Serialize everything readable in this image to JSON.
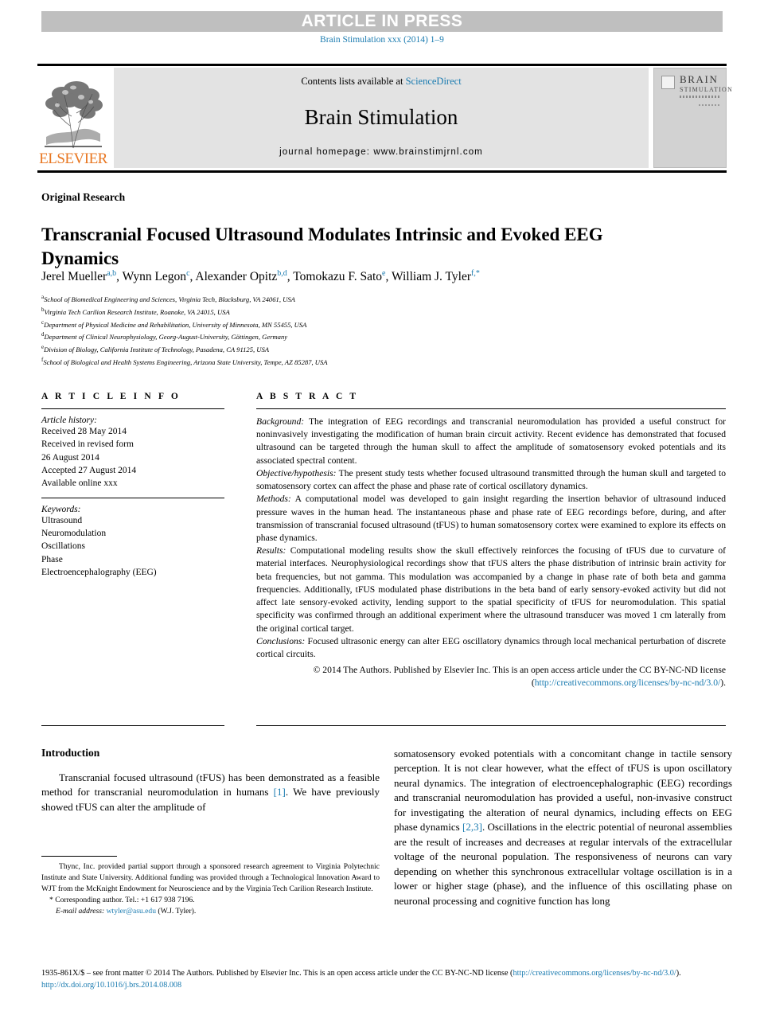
{
  "banner": {
    "text": "ARTICLE IN PRESS"
  },
  "journal_ref": "Brain Stimulation xxx (2014) 1–9",
  "masthead": {
    "contents_prefix": "Contents lists available at ",
    "sciencedirect": "ScienceDirect",
    "journal_title": "Brain Stimulation",
    "homepage": "journal homepage: www.brainstimjrnl.com",
    "publisher": "ELSEVIER",
    "cover_title_top": "BRAIN",
    "cover_title_bottom": "STIMULATION"
  },
  "article": {
    "kind": "Original Research",
    "title": "Transcranial Focused Ultrasound Modulates Intrinsic and Evoked EEG Dynamics",
    "authors": [
      {
        "name": "Jerel Mueller",
        "sup": "a,b"
      },
      {
        "name": "Wynn Legon",
        "sup": "c"
      },
      {
        "name": "Alexander Opitz",
        "sup": "b,d"
      },
      {
        "name": "Tomokazu F. Sato",
        "sup": "e"
      },
      {
        "name": "William J. Tyler",
        "sup": "f,*"
      }
    ],
    "affiliations": [
      {
        "mark": "a",
        "text": "School of Biomedical Engineering and Sciences, Virginia Tech, Blacksburg, VA 24061, USA"
      },
      {
        "mark": "b",
        "text": "Virginia Tech Carilion Research Institute, Roanoke, VA 24015, USA"
      },
      {
        "mark": "c",
        "text": "Department of Physical Medicine and Rehabilitation, University of Minnesota, MN 55455, USA"
      },
      {
        "mark": "d",
        "text": "Department of Clinical Neurophysiology, Georg-August-University, Göttingen, Germany"
      },
      {
        "mark": "e",
        "text": "Division of Biology, California Institute of Technology, Pasadena, CA 91125, USA"
      },
      {
        "mark": "f",
        "text": "School of Biological and Health Systems Engineering, Arizona State University, Tempe, AZ 85287, USA"
      }
    ]
  },
  "info": {
    "heading": "A R T I C L E   I N F O",
    "history_label": "Article history:",
    "history": [
      "Received 28 May 2014",
      "Received in revised form",
      "26 August 2014",
      "Accepted 27 August 2014",
      "Available online xxx"
    ],
    "keywords_label": "Keywords:",
    "keywords": [
      "Ultrasound",
      "Neuromodulation",
      "Oscillations",
      "Phase",
      "Electroencephalography (EEG)"
    ]
  },
  "abstract": {
    "heading": "A B S T R A C T",
    "sections": [
      {
        "label": "Background:",
        "text": " The integration of EEG recordings and transcranial neuromodulation has provided a useful construct for noninvasively investigating the modification of human brain circuit activity. Recent evidence has demonstrated that focused ultrasound can be targeted through the human skull to affect the amplitude of somatosensory evoked potentials and its associated spectral content."
      },
      {
        "label": "Objective/hypothesis:",
        "text": " The present study tests whether focused ultrasound transmitted through the human skull and targeted to somatosensory cortex can affect the phase and phase rate of cortical oscillatory dynamics."
      },
      {
        "label": "Methods:",
        "text": " A computational model was developed to gain insight regarding the insertion behavior of ultrasound induced pressure waves in the human head. The instantaneous phase and phase rate of EEG recordings before, during, and after transmission of transcranial focused ultrasound (tFUS) to human somatosensory cortex were examined to explore its effects on phase dynamics."
      },
      {
        "label": "Results:",
        "text": " Computational modeling results show the skull effectively reinforces the focusing of tFUS due to curvature of material interfaces. Neurophysiological recordings show that tFUS alters the phase distribution of intrinsic brain activity for beta frequencies, but not gamma. This modulation was accompanied by a change in phase rate of both beta and gamma frequencies. Additionally, tFUS modulated phase distributions in the beta band of early sensory-evoked activity but did not affect late sensory-evoked activity, lending support to the spatial specificity of tFUS for neuromodulation. This spatial specificity was confirmed through an additional experiment where the ultrasound transducer was moved 1 cm laterally from the original cortical target."
      },
      {
        "label": "Conclusions:",
        "text": " Focused ultrasonic energy can alter EEG oscillatory dynamics through local mechanical perturbation of discrete cortical circuits."
      }
    ],
    "copyright_text": "© 2014 The Authors. Published by Elsevier Inc. This is an open access article under the CC BY-NC-ND license (",
    "copyright_link": "http://creativecommons.org/licenses/by-nc-nd/3.0/",
    "copyright_suffix": ")."
  },
  "body": {
    "intro_heading": "Introduction",
    "left_paragraph_1": "Transcranial focused ultrasound (tFUS) has been demonstrated as a feasible method for transcranial neuromodulation in humans ",
    "left_ref_1": "[1]",
    "left_paragraph_1b": ". We have previously showed tFUS can alter the amplitude of",
    "right_paragraph_1": "somatosensory evoked potentials with a concomitant change in tactile sensory perception. It is not clear however, what the effect of tFUS is upon oscillatory neural dynamics. The integration of electroencephalographic (EEG) recordings and transcranial neuromodulation has provided a useful, non-invasive construct for investigating the alteration of neural dynamics, including effects on EEG phase dynamics ",
    "right_ref_1": "[2,3]",
    "right_paragraph_1b": ". Oscillations in the electric potential of neuronal assemblies are the result of increases and decreases at regular intervals of the extracellular voltage of the neuronal population. The responsiveness of neurons can vary depending on whether this synchronous extracellular voltage oscillation is in a lower or higher stage (phase), and the influence of this oscillating phase on neuronal processing and cognitive function has long"
  },
  "footnotes": {
    "funding": "Thync, Inc. provided partial support through a sponsored research agreement to Virginia Polytechnic Institute and State University. Additional funding was provided through a Technological Innovation Award to WJT from the McKnight Endowment for Neuroscience and by the Virginia Tech Carilion Research Institute.",
    "corresponding": "* Corresponding author. Tel.: +1 617 938 7196.",
    "email_label": "E-mail address:",
    "email": "wtyler@asu.edu",
    "email_owner": "(W.J. Tyler)."
  },
  "footer": {
    "issn_line": "1935-861X/$ – see front matter © 2014 The Authors. Published by Elsevier Inc. This is an open access article under the CC BY-NC-ND license (",
    "license_link": "http://creativecommons.org/licenses/by-nc-nd/3.0/",
    "license_suffix": ").",
    "doi": "http://dx.doi.org/10.1016/j.brs.2014.08.008"
  },
  "colors": {
    "link": "#1a7bb0",
    "banner_bg": "#bfbfbf",
    "elsevier_orange": "#e87722"
  }
}
